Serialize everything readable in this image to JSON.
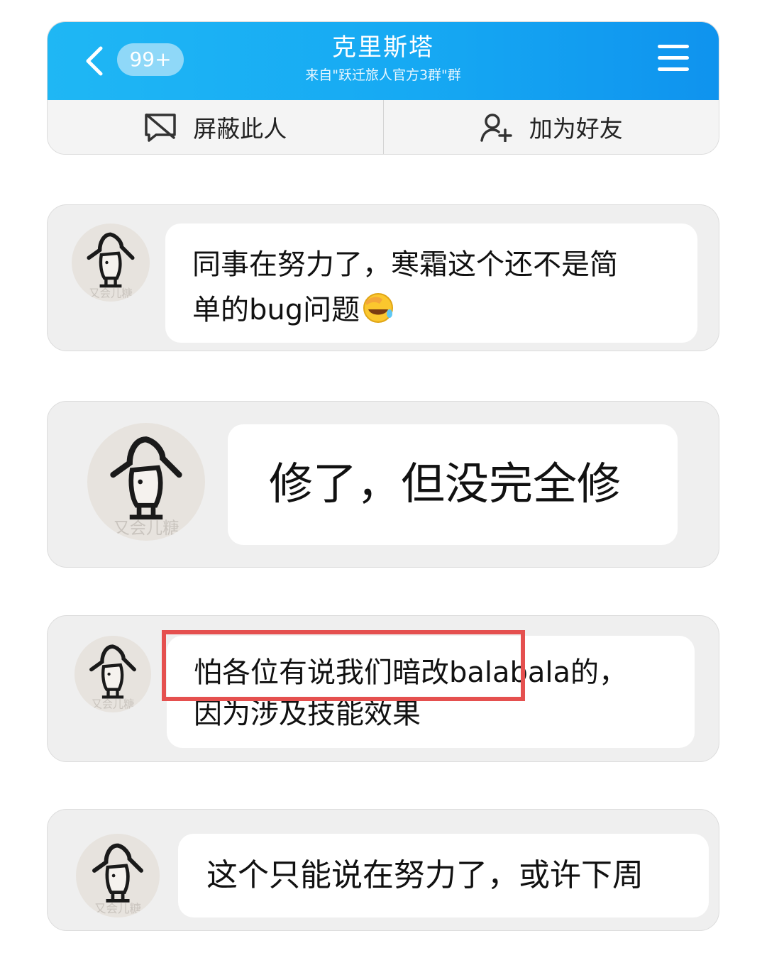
{
  "header": {
    "back_icon": "chevron-left-icon",
    "unread_badge": "99+",
    "title": "克里斯塔",
    "subtitle": "来自\"跃迁旅人官方3群\"群",
    "menu_icon": "hamburger-menu-icon",
    "colors": {
      "bar_start": "#1fb7f4",
      "bar_end": "#0f93ee"
    }
  },
  "actions": [
    {
      "label": "屏蔽此人",
      "icon": "block-user-icon"
    },
    {
      "label": "加为好友",
      "icon": "add-friend-icon"
    }
  ],
  "messages": [
    {
      "lines": [
        "同事在努力了，寒霜这个还不是简",
        "单的bug问题"
      ],
      "emoji": "facepalm-laugh-emoji",
      "avatar_text": "又会儿糖"
    },
    {
      "lines": [
        "修了，但没完全修"
      ],
      "avatar_text": "又会儿糖"
    },
    {
      "lines": [
        "怕各位有说我们暗改balabala的，",
        "因为涉及技能效果"
      ],
      "avatar_text": "又会儿糖",
      "highlight_color": "#e5504f"
    },
    {
      "lines": [
        "这个只能说在努力了，或许下周"
      ],
      "avatar_text": "又会儿糖"
    }
  ]
}
